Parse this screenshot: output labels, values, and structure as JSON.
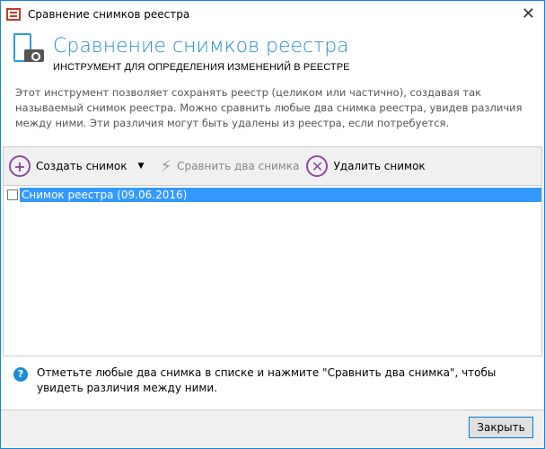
{
  "window": {
    "title": "Сравнение снимков реестра",
    "close_glyph": "✕"
  },
  "header": {
    "title": "Сравнение снимков реестра",
    "subtitle": "ИНСТРУМЕНТ ДЛЯ ОПРЕДЕЛЕНИЯ ИЗМЕНЕНИЙ В РЕЕСТРЕ",
    "description": "Этот инструмент позволяет сохранять реестр (целиком или частично), создавая так называемый снимок реестра. Можно сравнить любые два снимка реестра, увидев различия между ними. Эти различия могут быть удалены из реестра, если потребуется."
  },
  "toolbar": {
    "create": "Создать снимок",
    "compare": "Сравнить два снимка",
    "delete": "Удалить снимок"
  },
  "list": {
    "items": [
      {
        "label": "Снимок реестра (09.06.2016)",
        "checked": false,
        "selected": true
      }
    ]
  },
  "info": {
    "text": "Отметьте любые два снимка в списке и нажмите \"Сравнить два снимка\", чтобы увидеть различия между ними."
  },
  "footer": {
    "close": "Закрыть"
  }
}
